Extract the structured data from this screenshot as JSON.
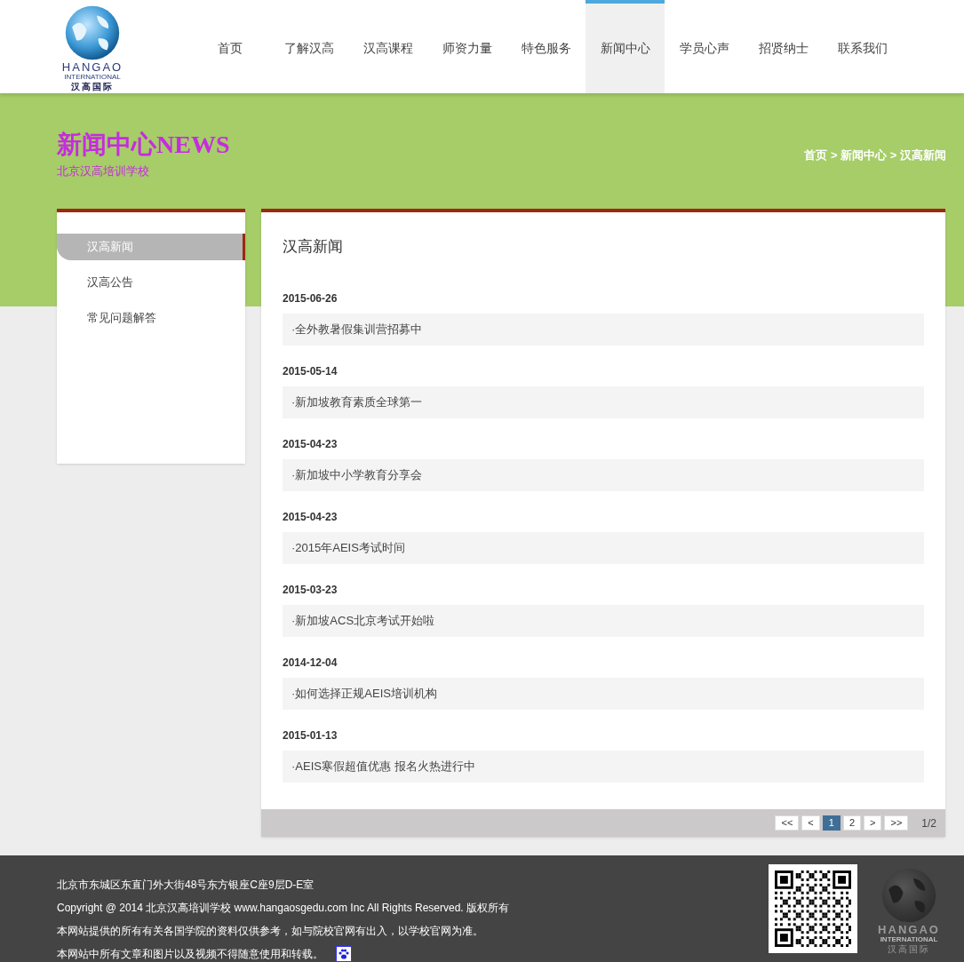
{
  "logo": {
    "line1": "HANGAO",
    "line2": "INTERNATIONAL",
    "line3": "汉高国际"
  },
  "nav": [
    {
      "label": "首页",
      "selected": false
    },
    {
      "label": "了解汉高",
      "selected": false
    },
    {
      "label": "汉高课程",
      "selected": false
    },
    {
      "label": "师资力量",
      "selected": false
    },
    {
      "label": "特色服务",
      "selected": false
    },
    {
      "label": "新闻中心",
      "selected": true
    },
    {
      "label": "学员心声",
      "selected": false
    },
    {
      "label": "招贤纳士",
      "selected": false
    },
    {
      "label": "联系我们",
      "selected": false
    }
  ],
  "banner": {
    "title": "新闻中心",
    "title_en": "NEWS",
    "subtitle": "北京汉高培训学校",
    "breadcrumb": "首页 > 新闻中心 > 汉高新闻"
  },
  "sidebar": {
    "items": [
      {
        "label": "汉高新闻",
        "selected": true
      },
      {
        "label": "汉高公告",
        "selected": false
      },
      {
        "label": "常见问题解答",
        "selected": false
      }
    ]
  },
  "content": {
    "heading": "汉高新闻",
    "news": [
      {
        "date": "2015-06-26",
        "title": "·全外教暑假集训营招募中"
      },
      {
        "date": "2015-05-14",
        "title": "·新加坡教育素质全球第一"
      },
      {
        "date": "2015-04-23",
        "title": "·新加坡中小学教育分享会"
      },
      {
        "date": "2015-04-23",
        "title": "·2015年AEIS考试时间"
      },
      {
        "date": "2015-03-23",
        "title": "·新加坡ACS北京考试开始啦"
      },
      {
        "date": "2014-12-04",
        "title": "·如何选择正规AEIS培训机构"
      },
      {
        "date": "2015-01-13",
        "title": "·AEIS寒假超值优惠 报名火热进行中"
      }
    ],
    "pagination": {
      "buttons": [
        {
          "label": "<<",
          "selected": false
        },
        {
          "label": "<",
          "selected": false
        },
        {
          "label": "1",
          "selected": true
        },
        {
          "label": "2",
          "selected": false
        },
        {
          "label": ">",
          "selected": false
        },
        {
          "label": ">>",
          "selected": false
        }
      ],
      "page_info": "1/2"
    }
  },
  "footer": {
    "lines": [
      "北京市东城区东直门外大街48号东方银座C座9层D-E室",
      "Copyright @ 2014 北京汉高培训学校 www.hangaosgedu.com Inc All Rights Reserved. 版权所有",
      "本网站提供的所有有关各国学院的资料仅供参考，如与院校官网有出入，以学校官网为准。",
      "本网站中所有文章和图片以及视频不得随意使用和转载。"
    ],
    "logo": {
      "line1": "HANGAO",
      "line2": "INTERNATIONAL",
      "line3": "汉高国际"
    }
  }
}
